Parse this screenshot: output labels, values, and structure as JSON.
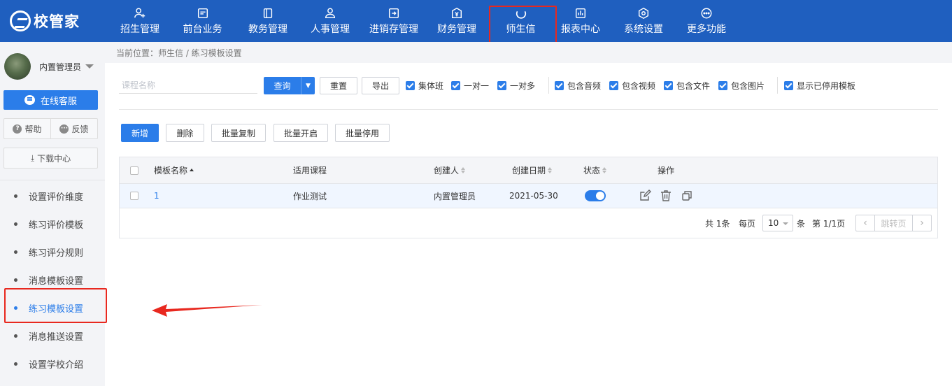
{
  "app": {
    "logo_text": "校管家"
  },
  "nav": {
    "items": [
      {
        "label": "招生管理",
        "icon": "user-plus-icon"
      },
      {
        "label": "前台业务",
        "icon": "card-icon"
      },
      {
        "label": "教务管理",
        "icon": "book-icon"
      },
      {
        "label": "人事管理",
        "icon": "person-icon"
      },
      {
        "label": "进销存管理",
        "icon": "inout-icon"
      },
      {
        "label": "财务管理",
        "icon": "money-icon"
      },
      {
        "label": "师生信",
        "icon": "chat-icon",
        "active": true
      },
      {
        "label": "报表中心",
        "icon": "chart-icon"
      },
      {
        "label": "系统设置",
        "icon": "gear-icon"
      },
      {
        "label": "更多功能",
        "icon": "more-icon"
      }
    ]
  },
  "sidebar": {
    "user_name": "内置管理员",
    "online_service": "在线客服",
    "help": "帮助",
    "feedback": "反馈",
    "download": "下载中心",
    "menu": [
      {
        "label": "设置评价维度"
      },
      {
        "label": "练习评价模板"
      },
      {
        "label": "练习评分规则"
      },
      {
        "label": "消息模板设置"
      },
      {
        "label": "练习模板设置",
        "active": true
      },
      {
        "label": "消息推送设置"
      },
      {
        "label": "设置学校介绍"
      }
    ]
  },
  "breadcrumb": {
    "text": "当前位置：师生信 / 练习模板设置"
  },
  "filters": {
    "search_placeholder": "课程名称",
    "query": "查询",
    "reset": "重置",
    "export": "导出",
    "checkboxes": [
      "集体班",
      "一对一",
      "一对多",
      "包含音频",
      "包含视频",
      "包含文件",
      "包含图片",
      "显示已停用模板"
    ]
  },
  "actions": {
    "add": "新增",
    "delete": "删除",
    "batch_copy": "批量复制",
    "batch_enable": "批量开启",
    "batch_disable": "批量停用"
  },
  "table": {
    "columns": {
      "name": "模板名称",
      "course": "适用课程",
      "creator": "创建人",
      "date": "创建日期",
      "status": "状态",
      "ops": "操作"
    },
    "rows": [
      {
        "name": "1",
        "course": "作业测试",
        "creator": "内置管理员",
        "date": "2021-05-30",
        "status_on": true
      }
    ]
  },
  "pagination": {
    "total": "共 1条",
    "per_page_label": "每页",
    "per_page": "10",
    "unit": "条",
    "page": "第 1/1页",
    "jump": "跳转页"
  },
  "colors": {
    "primary": "#2b7de9",
    "topbar": "#1f5fbf",
    "annotation": "#e8281f"
  }
}
